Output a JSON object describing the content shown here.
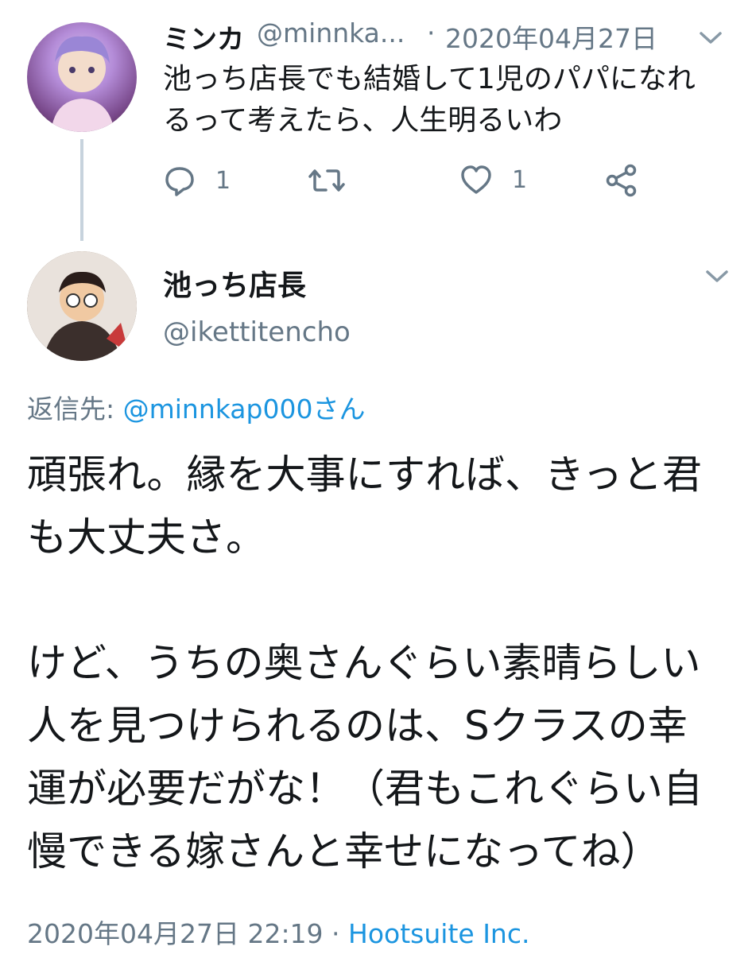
{
  "tweets": [
    {
      "name": "ミンカ",
      "handle": "@minnka...",
      "separator": "·",
      "date": "2020年04月27日",
      "text": "池っち店長でも結婚して1児のパパになれるって考えたら、人生明るいわ",
      "actions": {
        "reply_count": "1",
        "retweet_count": "",
        "like_count": "1"
      },
      "avatar_icon": "user-avatar-icon"
    },
    {
      "name": "池っち店長",
      "handle": "@ikettitencho",
      "reply_to_label": "返信先: ",
      "reply_to_mention": "@minnkap000さん",
      "body": "頑張れ。縁を大事にすれば、きっと君も大丈夫さ。\n\nけど、うちの奥さんぐらい素晴らしい人を見つけられるのは、Sクラスの幸運が必要だがな！（君もこれぐらい自慢できる嫁さんと幸せになってね）",
      "timestamp": "2020年04月27日 22:19",
      "separator": " · ",
      "source": "Hootsuite Inc.",
      "avatar_icon": "user-avatar-icon"
    }
  ],
  "colors": {
    "text": "#14171a",
    "muted": "#657786",
    "link": "#1b95e0",
    "thread_line": "#c7d3dd"
  }
}
